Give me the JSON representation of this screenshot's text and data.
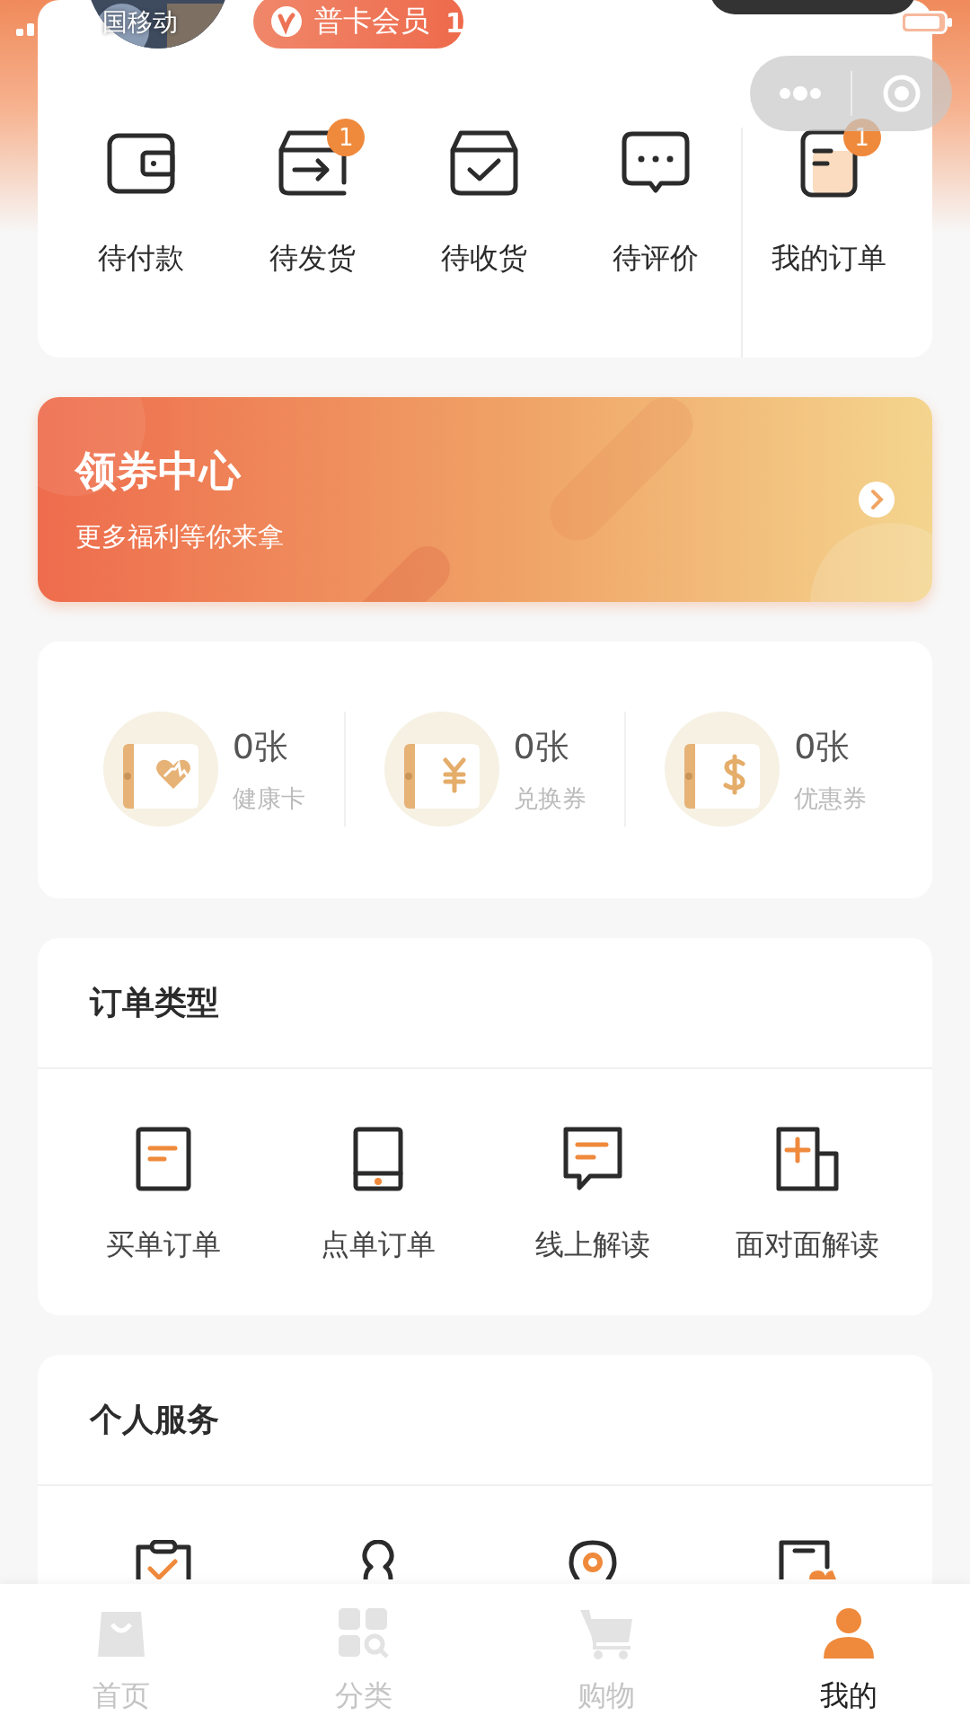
{
  "status_bar": {
    "carrier": "国移动"
  },
  "member_badge": {
    "label": "普卡会员",
    "extra": "1"
  },
  "order_status": [
    {
      "kind": "status",
      "label": "待付款"
    },
    {
      "kind": "status",
      "label": "待发货",
      "badge": "1"
    },
    {
      "kind": "status",
      "label": "待收货"
    },
    {
      "kind": "status",
      "label": "待评价"
    },
    {
      "kind": "all",
      "label": "我的订单",
      "badge": "1"
    }
  ],
  "coupon_banner": {
    "title": "领券中心",
    "subtitle": "更多福利等你来拿"
  },
  "vouchers": [
    {
      "count": "0张",
      "label": "健康卡"
    },
    {
      "count": "0张",
      "label": "兑换券"
    },
    {
      "count": "0张",
      "label": "优惠券"
    }
  ],
  "order_types": {
    "title": "订单类型",
    "items": [
      {
        "label": "买单订单"
      },
      {
        "label": "点单订单"
      },
      {
        "label": "线上解读"
      },
      {
        "label": "面对面解读"
      }
    ]
  },
  "personal_services": {
    "title": "个人服务"
  },
  "tab_bar": [
    {
      "label": "首页",
      "selected": false
    },
    {
      "label": "分类",
      "selected": false
    },
    {
      "label": "购物",
      "selected": false
    },
    {
      "label": "我的",
      "selected": true
    }
  ]
}
